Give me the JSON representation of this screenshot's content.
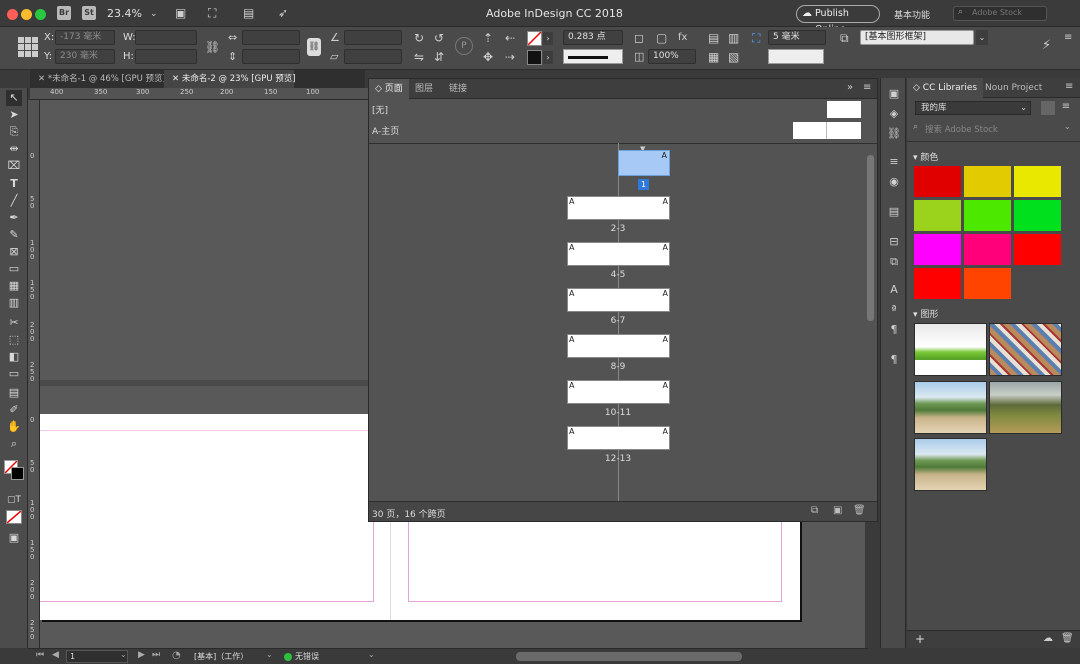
{
  "titlebar": {
    "app_title": "Adobe InDesign CC 2018",
    "zoom": "23.4%",
    "br_icon": "Br",
    "st_icon": "St",
    "publish_label": "Publish Online",
    "workspace": "基本功能",
    "search_placeholder": "Adobe Stock"
  },
  "controlbar": {
    "x_label": "X:",
    "x_value": "-173 毫米",
    "y_label": "Y:",
    "y_value": "230 毫米",
    "w_label": "W:",
    "h_label": "H:",
    "stroke_weight": "0.283 点",
    "opacity": "100%",
    "spacing": "5 毫米",
    "frame_style": "[基本图形框架]"
  },
  "doc_tabs": [
    {
      "label": "*未命名-1 @ 46% [GPU 预览]"
    },
    {
      "label": "未命名-2 @ 23% [GPU 预览]"
    }
  ],
  "ruler": {
    "h_ticks": [
      "400",
      "350",
      "300",
      "250",
      "200",
      "150",
      "100"
    ],
    "v_ticks": [
      "0",
      "50",
      "100",
      "150",
      "200",
      "250",
      "0",
      "50",
      "100",
      "150",
      "200",
      "250"
    ]
  },
  "pages_panel": {
    "tabs": [
      "页面",
      "图层",
      "链接"
    ],
    "none_master": "[无]",
    "a_master": "A-主页",
    "first_page": "1",
    "spreads": [
      "2-3",
      "4-5",
      "6-7",
      "8-9",
      "10-11",
      "12-13"
    ],
    "status": "30 页，16 个跨页"
  },
  "libraries": {
    "tabs": [
      "CC Libraries",
      "Noun Project"
    ],
    "library": "我的库",
    "search_placeholder": "搜索 Adobe Stock",
    "colors_header": "颜色",
    "graphics_header": "图形",
    "swatches": [
      "#e00000",
      "#e2cc00",
      "#e8e800",
      "#9ad21c",
      "#4ce800",
      "#00e01c",
      "#ff00ff",
      "#ff007a",
      "#ff0000",
      "#ff0000",
      "#ff4400"
    ]
  },
  "statusbar": {
    "page": "1",
    "style": "[基本]（工作）",
    "errors": "无错误"
  }
}
